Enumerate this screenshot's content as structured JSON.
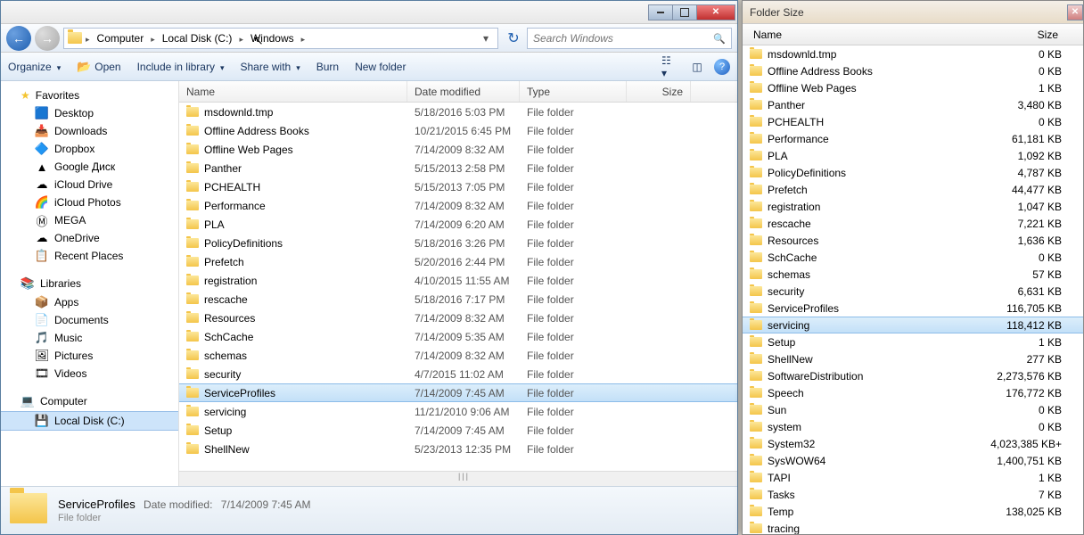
{
  "explorer": {
    "breadcrumb": {
      "seg1": "Computer",
      "seg2": "Local Disk (C:)",
      "seg3": "Windows"
    },
    "search_placeholder": "Search Windows",
    "toolbar": {
      "organize": "Organize",
      "open": "Open",
      "include": "Include in library",
      "share": "Share with",
      "burn": "Burn",
      "newfolder": "New folder"
    },
    "nav": {
      "favorites": "Favorites",
      "fav_items": [
        {
          "label": "Desktop",
          "icon": "🟦"
        },
        {
          "label": "Downloads",
          "icon": "📥"
        },
        {
          "label": "Dropbox",
          "icon": "🔷"
        },
        {
          "label": "Google Диск",
          "icon": "▲"
        },
        {
          "label": "iCloud Drive",
          "icon": "☁"
        },
        {
          "label": "iCloud Photos",
          "icon": "🌈"
        },
        {
          "label": "MEGA",
          "icon": "Ⓜ"
        },
        {
          "label": "OneDrive",
          "icon": "☁"
        },
        {
          "label": "Recent Places",
          "icon": "📋"
        }
      ],
      "libraries": "Libraries",
      "lib_items": [
        {
          "label": "Apps",
          "icon": "📦"
        },
        {
          "label": "Documents",
          "icon": "📄"
        },
        {
          "label": "Music",
          "icon": "🎵"
        },
        {
          "label": "Pictures",
          "icon": "🖼"
        },
        {
          "label": "Videos",
          "icon": "🎞"
        }
      ],
      "computer": "Computer",
      "comp_items": [
        {
          "label": "Local Disk (C:)",
          "icon": "💾",
          "selected": true
        }
      ]
    },
    "columns": {
      "name": "Name",
      "date": "Date modified",
      "type": "Type",
      "size": "Size"
    },
    "files": [
      {
        "name": "msdownld.tmp",
        "date": "5/18/2016 5:03 PM",
        "type": "File folder"
      },
      {
        "name": "Offline Address Books",
        "date": "10/21/2015 6:45 PM",
        "type": "File folder"
      },
      {
        "name": "Offline Web Pages",
        "date": "7/14/2009 8:32 AM",
        "type": "File folder"
      },
      {
        "name": "Panther",
        "date": "5/15/2013 2:58 PM",
        "type": "File folder"
      },
      {
        "name": "PCHEALTH",
        "date": "5/15/2013 7:05 PM",
        "type": "File folder"
      },
      {
        "name": "Performance",
        "date": "7/14/2009 8:32 AM",
        "type": "File folder"
      },
      {
        "name": "PLA",
        "date": "7/14/2009 6:20 AM",
        "type": "File folder"
      },
      {
        "name": "PolicyDefinitions",
        "date": "5/18/2016 3:26 PM",
        "type": "File folder"
      },
      {
        "name": "Prefetch",
        "date": "5/20/2016 2:44 PM",
        "type": "File folder"
      },
      {
        "name": "registration",
        "date": "4/10/2015 11:55 AM",
        "type": "File folder"
      },
      {
        "name": "rescache",
        "date": "5/18/2016 7:17 PM",
        "type": "File folder"
      },
      {
        "name": "Resources",
        "date": "7/14/2009 8:32 AM",
        "type": "File folder"
      },
      {
        "name": "SchCache",
        "date": "7/14/2009 5:35 AM",
        "type": "File folder"
      },
      {
        "name": "schemas",
        "date": "7/14/2009 8:32 AM",
        "type": "File folder"
      },
      {
        "name": "security",
        "date": "4/7/2015 11:02 AM",
        "type": "File folder"
      },
      {
        "name": "ServiceProfiles",
        "date": "7/14/2009 7:45 AM",
        "type": "File folder",
        "selected": true
      },
      {
        "name": "servicing",
        "date": "11/21/2010 9:06 AM",
        "type": "File folder"
      },
      {
        "name": "Setup",
        "date": "7/14/2009 7:45 AM",
        "type": "File folder"
      },
      {
        "name": "ShellNew",
        "date": "5/23/2013 12:35 PM",
        "type": "File folder"
      }
    ],
    "details": {
      "name": "ServiceProfiles",
      "meta_label": "Date modified:",
      "meta_value": "7/14/2009 7:45 AM",
      "type_label": "File folder"
    }
  },
  "foldersize": {
    "title": "Folder Size",
    "col_name": "Name",
    "col_size": "Size",
    "items": [
      {
        "name": "msdownld.tmp",
        "size": "0 KB"
      },
      {
        "name": "Offline Address Books",
        "size": "0 KB"
      },
      {
        "name": "Offline Web Pages",
        "size": "1 KB"
      },
      {
        "name": "Panther",
        "size": "3,480 KB"
      },
      {
        "name": "PCHEALTH",
        "size": "0 KB"
      },
      {
        "name": "Performance",
        "size": "61,181 KB"
      },
      {
        "name": "PLA",
        "size": "1,092 KB"
      },
      {
        "name": "PolicyDefinitions",
        "size": "4,787 KB"
      },
      {
        "name": "Prefetch",
        "size": "44,477 KB"
      },
      {
        "name": "registration",
        "size": "1,047 KB"
      },
      {
        "name": "rescache",
        "size": "7,221 KB"
      },
      {
        "name": "Resources",
        "size": "1,636 KB"
      },
      {
        "name": "SchCache",
        "size": "0 KB"
      },
      {
        "name": "schemas",
        "size": "57 KB"
      },
      {
        "name": "security",
        "size": "6,631 KB"
      },
      {
        "name": "ServiceProfiles",
        "size": "116,705 KB"
      },
      {
        "name": "servicing",
        "size": "118,412 KB",
        "selected": true
      },
      {
        "name": "Setup",
        "size": "1 KB"
      },
      {
        "name": "ShellNew",
        "size": "277 KB"
      },
      {
        "name": "SoftwareDistribution",
        "size": "2,273,576 KB"
      },
      {
        "name": "Speech",
        "size": "176,772 KB"
      },
      {
        "name": "Sun",
        "size": "0 KB"
      },
      {
        "name": "system",
        "size": "0 KB"
      },
      {
        "name": "System32",
        "size": "4,023,385 KB+"
      },
      {
        "name": "SysWOW64",
        "size": "1,400,751 KB"
      },
      {
        "name": "TAPI",
        "size": "1 KB"
      },
      {
        "name": "Tasks",
        "size": "7 KB"
      },
      {
        "name": "Temp",
        "size": "138,025 KB"
      },
      {
        "name": "tracing",
        "size": ""
      }
    ]
  }
}
